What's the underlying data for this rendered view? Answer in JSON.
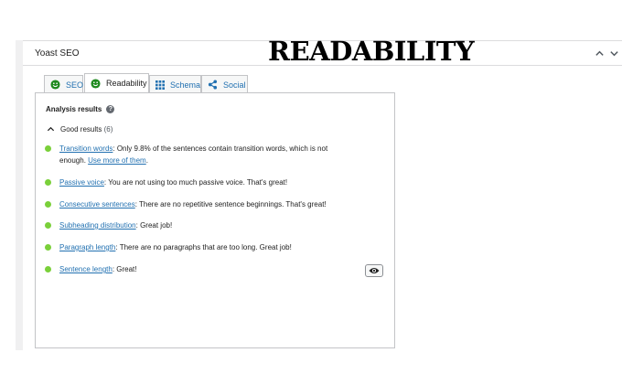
{
  "metabox": {
    "title": "Yoast SEO",
    "overlay_heading": "READABILITY"
  },
  "tabs": [
    {
      "label": "SEO",
      "icon": "smiley-icon",
      "active": false
    },
    {
      "label": "Readability",
      "icon": "smiley-icon",
      "active": true
    },
    {
      "label": "Schema",
      "icon": "grid-icon",
      "active": false
    },
    {
      "label": "Social",
      "icon": "share-icon",
      "active": false
    }
  ],
  "analysis": {
    "title": "Analysis results",
    "good_results_label": "Good results",
    "good_results_count": "(6)",
    "results": [
      {
        "link": "Transition words",
        "text": ": Only 9.8% of the sentences contain transition words, which is not enough. ",
        "link2": "Use more of them",
        "tail": "."
      },
      {
        "link": "Passive voice",
        "text": ": You are not using too much passive voice. That's great!"
      },
      {
        "link": "Consecutive sentences",
        "text": ": There are no repetitive sentence beginnings. That's great!"
      },
      {
        "link": "Subheading distribution",
        "text": ": Great job!"
      },
      {
        "link": "Paragraph length",
        "text": ": There are no paragraphs that are too long. Great job!"
      },
      {
        "link": "Sentence length",
        "text": ": Great!"
      }
    ]
  },
  "colors": {
    "good_bullet": "#7ad03a",
    "smiley_green": "#1f8a1f",
    "link_blue": "#2271b1"
  }
}
